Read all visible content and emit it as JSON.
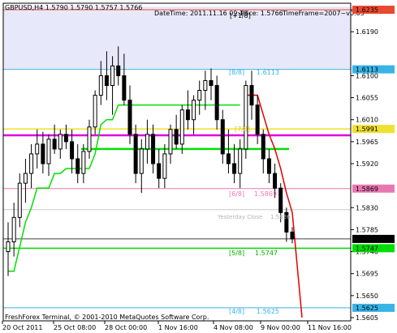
{
  "colors": {
    "background": "#ffffff",
    "plot_border": "#000000",
    "band_fill": "#e8e8fb",
    "candle": "#000000",
    "trend_up": "#00e000",
    "trend_down": "#e00000",
    "level_8_8": "#39b4e6",
    "level_6_8": "#e878b2",
    "level_5_8": "#00dd00",
    "level_4_8": "#39b4e6",
    "top_level": "#e84a2f",
    "magenta_level": "#e000e0",
    "yellow_level": "#f0e030",
    "green_level": "#00e000",
    "yesterday_close": "#c8c8c8"
  },
  "header": {
    "symbol_bar": "GBPUSD,H4  1.5790 1.5790 1.5757 1.5766",
    "datetime": "DateTime: 2011.11.16 09:13",
    "price": "Price: 1.5766",
    "timeframe": "TimeFrame=2007~v0.05",
    "overlay_fragment": "[+1/8]"
  },
  "levels": {
    "lvl_8_8": {
      "label": "[8/8]",
      "value": "1.6113"
    },
    "lvl_6_8": {
      "label": "[6/8]",
      "value": "1.5869"
    },
    "lvl_5_8": {
      "label": "[5/8]",
      "value": "1.5747"
    },
    "lvl_4_8": {
      "label": "[4/8]",
      "value": "1.5625"
    },
    "lvl_yellow": {
      "label": "[7/8]",
      "value": "1.5991"
    },
    "yesterday_close": {
      "label": "Yesterday Close",
      "value": "1.5826"
    }
  },
  "copyright": "FreshForex Terminal, © 2001-2010 MetaQuotes Software Corp.",
  "price_axis": {
    "ticks": [
      "1.6235",
      "1.6190",
      "1.6100",
      "1.6055",
      "1.6010",
      "1.5965",
      "1.5920",
      "1.5830",
      "1.5785",
      "1.5740",
      "1.5695",
      "1.5650",
      "1.5605"
    ],
    "highlights": [
      {
        "name": "top",
        "value": "1.6235"
      },
      {
        "name": "lvl-8-8",
        "value": "1.6113"
      },
      {
        "name": "yellow",
        "value": "1.5991"
      },
      {
        "name": "lvl-6-8",
        "value": "1.5869"
      },
      {
        "name": "current",
        "value": "1.5766"
      },
      {
        "name": "lvl-5-8",
        "value": "1.5747"
      },
      {
        "name": "lvl-4-8",
        "value": "1.5625"
      }
    ]
  },
  "time_axis": [
    "20 Oct 2011",
    "25 Oct 08:00",
    "28 Oct 00:00",
    "1 Nov 16:00",
    "4 Nov 08:00",
    "9 Nov 00:00",
    "11 Nov 16:00"
  ],
  "chart_data": {
    "type": "candlestick",
    "symbol": "GBPUSD",
    "timeframe": "H4",
    "ylim": [
      1.5605,
      1.6235
    ],
    "current_price": 1.5766,
    "candles": [
      [
        1.574,
        1.58,
        1.569,
        1.576
      ],
      [
        1.576,
        1.584,
        1.573,
        1.581
      ],
      [
        1.581,
        1.59,
        1.579,
        1.588
      ],
      [
        1.588,
        1.593,
        1.584,
        1.59
      ],
      [
        1.59,
        1.596,
        1.587,
        1.594
      ],
      [
        1.594,
        1.599,
        1.591,
        1.596
      ],
      [
        1.596,
        1.5985,
        1.59,
        1.592
      ],
      [
        1.592,
        1.598,
        1.5895,
        1.597
      ],
      [
        1.597,
        1.6,
        1.594,
        1.595
      ],
      [
        1.595,
        1.599,
        1.593,
        1.598
      ],
      [
        1.598,
        1.6,
        1.595,
        1.5965
      ],
      [
        1.5965,
        1.599,
        1.59,
        1.593
      ],
      [
        1.593,
        1.596,
        1.588,
        1.59
      ],
      [
        1.59,
        1.596,
        1.588,
        1.5945
      ],
      [
        1.5945,
        1.601,
        1.593,
        1.5995
      ],
      [
        1.5995,
        1.607,
        1.598,
        1.606
      ],
      [
        1.606,
        1.613,
        1.604,
        1.61
      ],
      [
        1.61,
        1.615,
        1.605,
        1.608
      ],
      [
        1.608,
        1.614,
        1.602,
        1.612
      ],
      [
        1.612,
        1.616,
        1.608,
        1.61
      ],
      [
        1.61,
        1.6145,
        1.604,
        1.605
      ],
      [
        1.605,
        1.608,
        1.596,
        1.598
      ],
      [
        1.598,
        1.6,
        1.588,
        1.59
      ],
      [
        1.59,
        1.597,
        1.586,
        1.595
      ],
      [
        1.595,
        1.601,
        1.592,
        1.598
      ],
      [
        1.598,
        1.6,
        1.59,
        1.592
      ],
      [
        1.592,
        1.595,
        1.587,
        1.589
      ],
      [
        1.589,
        1.596,
        1.587,
        1.594
      ],
      [
        1.594,
        1.6,
        1.592,
        1.599
      ],
      [
        1.599,
        1.602,
        1.595,
        1.596
      ],
      [
        1.596,
        1.604,
        1.594,
        1.603
      ],
      [
        1.603,
        1.607,
        1.599,
        1.601
      ],
      [
        1.601,
        1.606,
        1.598,
        1.605
      ],
      [
        1.605,
        1.609,
        1.602,
        1.607
      ],
      [
        1.607,
        1.611,
        1.603,
        1.609
      ],
      [
        1.609,
        1.6115,
        1.605,
        1.608
      ],
      [
        1.608,
        1.61,
        1.599,
        1.601
      ],
      [
        1.601,
        1.603,
        1.592,
        1.594
      ],
      [
        1.594,
        1.599,
        1.59,
        1.592
      ],
      [
        1.592,
        1.596,
        1.588,
        1.59
      ],
      [
        1.59,
        1.597,
        1.587,
        1.595
      ],
      [
        1.595,
        1.609,
        1.593,
        1.608
      ],
      [
        1.608,
        1.611,
        1.601,
        1.604
      ],
      [
        1.604,
        1.606,
        1.596,
        1.598
      ],
      [
        1.598,
        1.599,
        1.59,
        1.593
      ],
      [
        1.593,
        1.595,
        1.588,
        1.59
      ],
      [
        1.59,
        1.592,
        1.585,
        1.587
      ],
      [
        1.587,
        1.588,
        1.58,
        1.582
      ],
      [
        1.582,
        1.583,
        1.576,
        1.578
      ],
      [
        1.578,
        1.579,
        1.5757,
        1.5766
      ]
    ]
  }
}
